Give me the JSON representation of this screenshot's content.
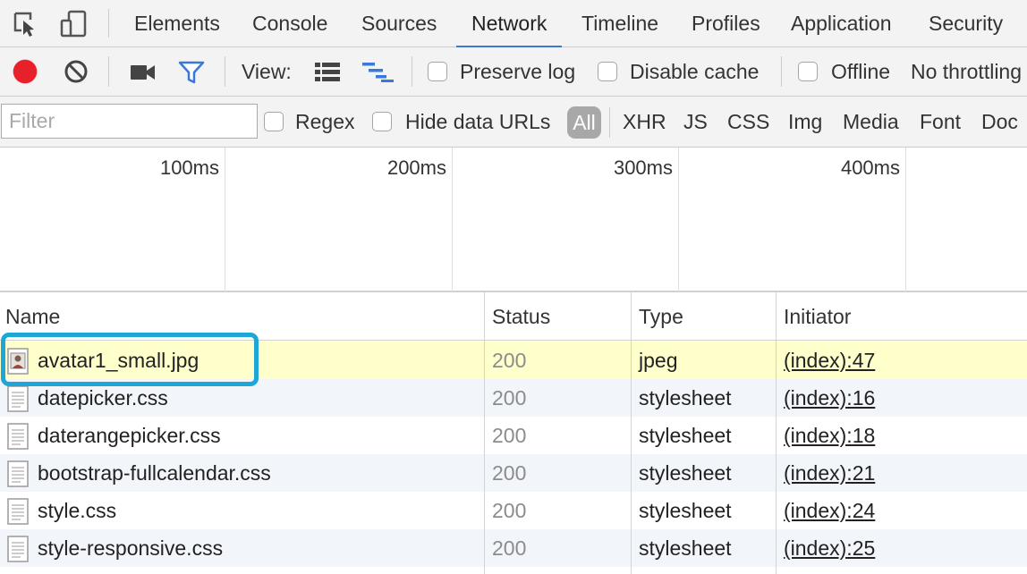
{
  "tabs": [
    {
      "label": "Elements"
    },
    {
      "label": "Console"
    },
    {
      "label": "Sources"
    },
    {
      "label": "Network",
      "active": true
    },
    {
      "label": "Timeline"
    },
    {
      "label": "Profiles"
    },
    {
      "label": "Application"
    },
    {
      "label": "Security"
    }
  ],
  "toolbar": {
    "view_label": "View:",
    "preserve_log": "Preserve log",
    "disable_cache": "Disable cache",
    "offline": "Offline",
    "throttling": "No throttling",
    "record_color": "#e8202a",
    "filter_icon_color": "#3879d9"
  },
  "filterbar": {
    "placeholder": "Filter",
    "regex": "Regex",
    "hide_data_urls": "Hide data URLs",
    "all": "All",
    "types": [
      "XHR",
      "JS",
      "CSS",
      "Img",
      "Media",
      "Font",
      "Doc"
    ]
  },
  "overview": {
    "labels": [
      "100ms",
      "200ms",
      "300ms",
      "400ms"
    ]
  },
  "table": {
    "headers": {
      "name": "Name",
      "status": "Status",
      "type": "Type",
      "initiator": "Initiator"
    },
    "rows": [
      {
        "name": "avatar1_small.jpg",
        "status": "200",
        "type": "jpeg",
        "initiator": "(index):47",
        "icon": "image-file-icon",
        "selected": true
      },
      {
        "name": "datepicker.css",
        "status": "200",
        "type": "stylesheet",
        "initiator": "(index):16",
        "icon": "document-file-icon"
      },
      {
        "name": "daterangepicker.css",
        "status": "200",
        "type": "stylesheet",
        "initiator": "(index):18",
        "icon": "document-file-icon"
      },
      {
        "name": "bootstrap-fullcalendar.css",
        "status": "200",
        "type": "stylesheet",
        "initiator": "(index):21",
        "icon": "document-file-icon"
      },
      {
        "name": "style.css",
        "status": "200",
        "type": "stylesheet",
        "initiator": "(index):24",
        "icon": "document-file-icon"
      },
      {
        "name": "style-responsive.css",
        "status": "200",
        "type": "stylesheet",
        "initiator": "(index):25",
        "icon": "document-file-icon"
      }
    ]
  },
  "highlight_color": "#1ea7d6"
}
